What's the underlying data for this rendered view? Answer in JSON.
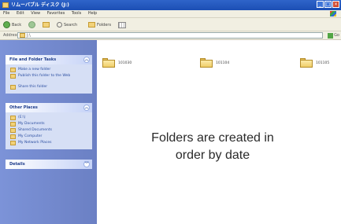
{
  "window": {
    "title": "リムーバブル ディスク (J:)",
    "controls": [
      "_",
      "□",
      "×"
    ]
  },
  "menubar": {
    "items": [
      "File",
      "Edit",
      "View",
      "Favorites",
      "Tools",
      "Help"
    ]
  },
  "toolbar": {
    "back_label": "Back",
    "search_label": "Search",
    "folders_label": "Folders"
  },
  "address": {
    "label": "Address",
    "value": "J:\\",
    "go_label": "Go"
  },
  "sidebar": {
    "file_tasks": {
      "title": "File and Folder Tasks",
      "items": [
        "Make a new folder",
        "Publish this folder to the Web",
        "Share this folder"
      ]
    },
    "other_places": {
      "title": "Other Places",
      "items": [
        "(E:\\)",
        "My Documents",
        "Shared Documents",
        "My Computer",
        "My Network Places"
      ]
    },
    "details": {
      "title": "Details"
    }
  },
  "content": {
    "folders": [
      "101030",
      "101104",
      "101105"
    ]
  },
  "caption": {
    "line1": "Folders are created in",
    "line2": "order by date"
  }
}
